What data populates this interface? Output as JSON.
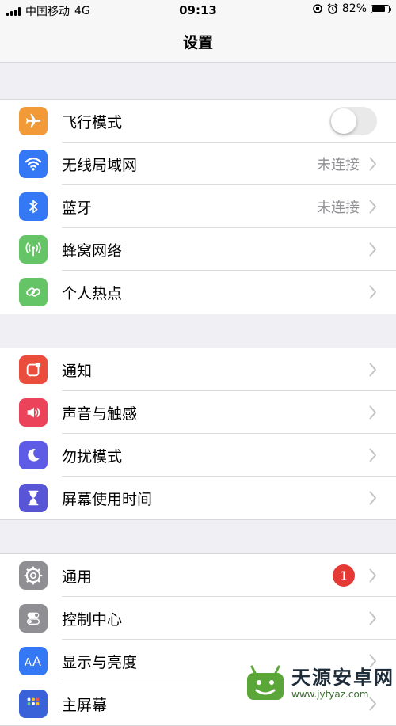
{
  "status_bar": {
    "carrier": "中国移动",
    "network": "4G",
    "time": "09:13",
    "battery": "82%",
    "battery_level": 0.82
  },
  "nav": {
    "title": "设置"
  },
  "groups": [
    {
      "rows": [
        {
          "label": "飞行模式",
          "icon": "airplane-icon",
          "color": "#f19a37",
          "toggle": false
        },
        {
          "label": "无线局域网",
          "detail": "未连接",
          "icon": "wifi-icon",
          "color": "#3478f6"
        },
        {
          "label": "蓝牙",
          "detail": "未连接",
          "icon": "bluetooth-icon",
          "color": "#3478f6"
        },
        {
          "label": "蜂窝网络",
          "icon": "cellular-icon",
          "color": "#65c466"
        },
        {
          "label": "个人热点",
          "icon": "hotspot-icon",
          "color": "#65c466"
        }
      ]
    },
    {
      "rows": [
        {
          "label": "通知",
          "icon": "notifications-icon",
          "color": "#eb4d3d"
        },
        {
          "label": "声音与触感",
          "icon": "sound-icon",
          "color": "#eb445a"
        },
        {
          "label": "勿扰模式",
          "icon": "moon-icon",
          "color": "#5e5ce6"
        },
        {
          "label": "屏幕使用时间",
          "icon": "hourglass-icon",
          "color": "#5856d6"
        }
      ]
    },
    {
      "rows": [
        {
          "label": "通用",
          "badge": "1",
          "icon": "gear-icon",
          "color": "#8e8e93"
        },
        {
          "label": "控制中心",
          "icon": "control-center-icon",
          "color": "#8e8e93"
        },
        {
          "label": "显示与亮度",
          "icon": "display-icon",
          "color": "#3478f6"
        },
        {
          "label": "主屏幕",
          "icon": "home-screen-icon",
          "color": "#3a62d8"
        }
      ]
    }
  ],
  "watermark": {
    "title": "天源安卓网",
    "url": "www.jytyaz.com"
  }
}
